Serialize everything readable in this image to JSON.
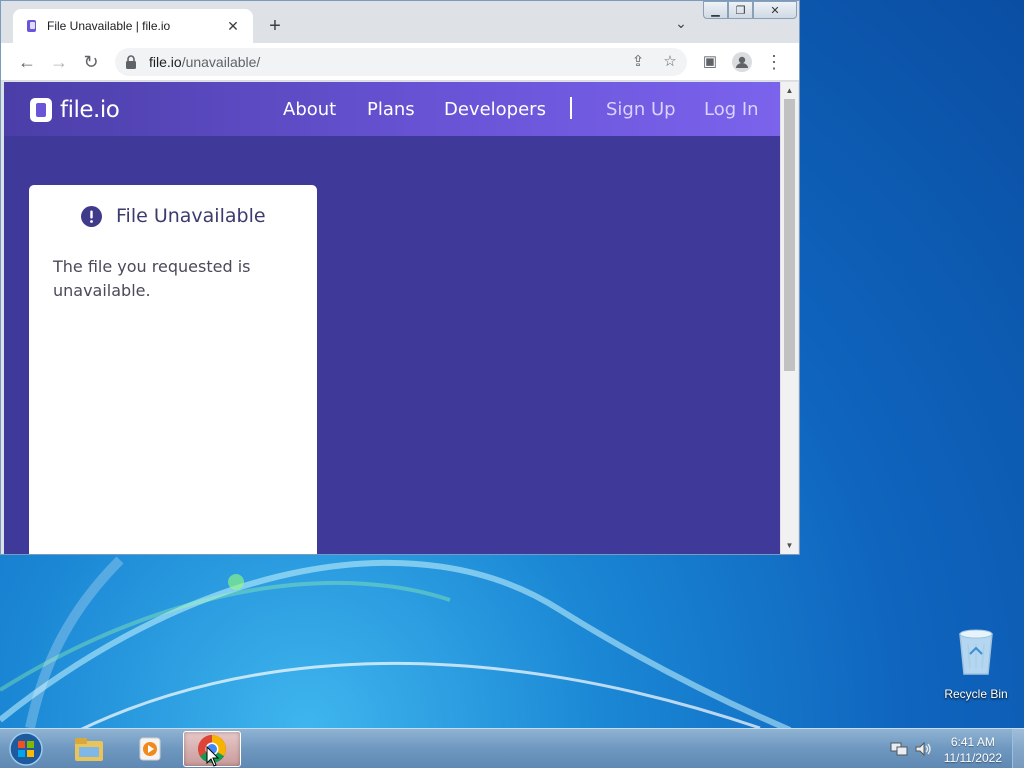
{
  "browser": {
    "tab_title": "File Unavailable | file.io",
    "url_host": "file.io",
    "url_path": "/unavailable/",
    "new_tab_symbol": "+",
    "tab_close_symbol": "✕"
  },
  "site": {
    "logo_text": "file.io",
    "nav": {
      "about": "About",
      "plans": "Plans",
      "developers": "Developers",
      "sign_up": "Sign Up",
      "log_in": "Log In"
    },
    "card": {
      "heading": "File Unavailable",
      "message": "The file you requested is unavailable."
    },
    "colors": {
      "page_bg": "#3f3a9a",
      "header_accent": "#7b63ec",
      "heading_text": "#3c3b6e"
    }
  },
  "desktop": {
    "icons": [
      {
        "label": "Recycle Bin",
        "icon": "recycle-bin-icon"
      }
    ]
  },
  "taskbar": {
    "time": "6:41 AM",
    "date": "11/11/2022",
    "pinned": [
      "file-explorer-icon",
      "media-player-icon",
      "chrome-icon"
    ]
  }
}
